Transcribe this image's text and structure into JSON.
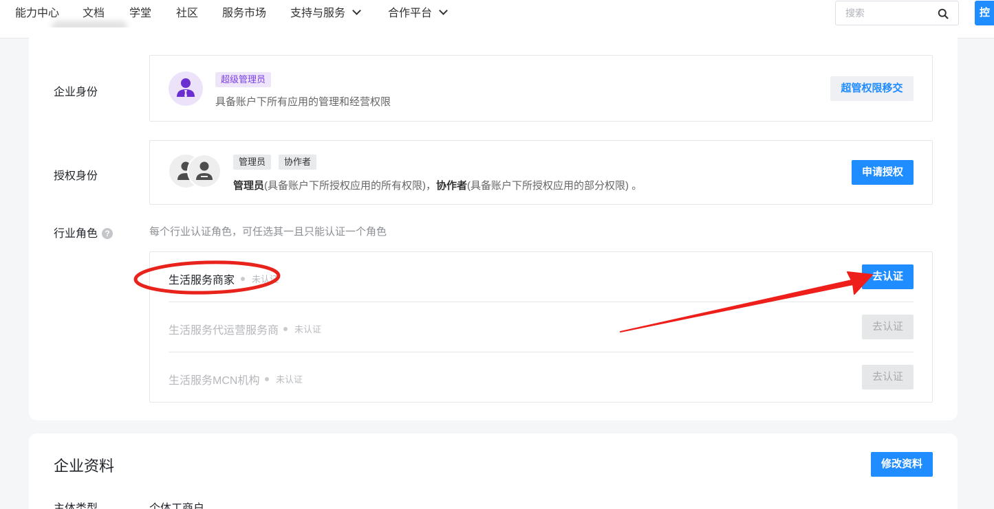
{
  "nav": {
    "items": [
      {
        "label": "能力中心"
      },
      {
        "label": "文档"
      },
      {
        "label": "学堂"
      },
      {
        "label": "社区"
      },
      {
        "label": "服务市场"
      },
      {
        "label": "支持与服务",
        "has_dropdown": true
      },
      {
        "label": "合作平台",
        "has_dropdown": true
      }
    ],
    "search_placeholder": "搜索",
    "console_button": "控",
    "accent_color": "#1f8cff"
  },
  "enterprise_identity": {
    "label": "企业身份",
    "tag": "超级管理员",
    "description": "具备账户下所有应用的管理和经营权限",
    "button": "超管权限移交",
    "icon": "super-admin-avatar-icon"
  },
  "authorized_identity": {
    "label": "授权身份",
    "tags": [
      "管理员",
      "协作者"
    ],
    "desc_admin": "管理员",
    "desc_admin_text": "(具备账户下所授权应用的所有权限)，",
    "desc_collab": "协作者",
    "desc_collab_text": "(具备账户下所授权应用的部分权限) 。",
    "button": "申请授权",
    "icon": "admin-avatars-icon"
  },
  "industry_role": {
    "label": "行业角色",
    "help_icon": "question-circle-icon",
    "help_glyph": "?",
    "hint": "每个行业认证角色，可任选其一且只能认证一个角色",
    "roles": [
      {
        "name": "生活服务商家",
        "status": "未认证",
        "button": "去认证",
        "enabled": true
      },
      {
        "name": "生活服务代运营服务商",
        "status": "未认证",
        "button": "去认证",
        "enabled": false
      },
      {
        "name": "生活服务MCN机构",
        "status": "未认证",
        "button": "去认证",
        "enabled": false
      }
    ]
  },
  "company_profile": {
    "title": "企业资料",
    "edit_button": "修改资料",
    "fields": [
      {
        "label": "主体类型",
        "value": "个体工商户"
      }
    ]
  },
  "annotation_colors": {
    "ellipse": "#e8231b",
    "arrow": "#ee1f1a"
  }
}
